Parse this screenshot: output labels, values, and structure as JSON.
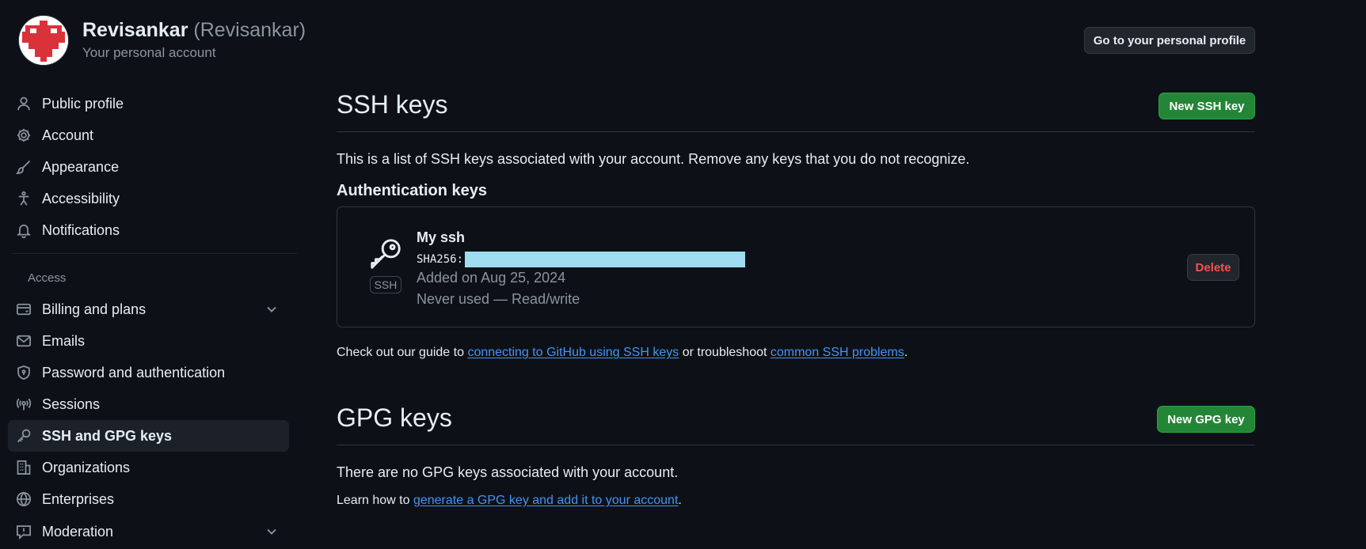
{
  "header": {
    "display_name": "Revisankar",
    "handle": "(Revisankar)",
    "subtitle": "Your personal account",
    "profile_button": "Go to your personal profile"
  },
  "sidebar": {
    "items": [
      {
        "label": "Public profile",
        "icon": "person-icon"
      },
      {
        "label": "Account",
        "icon": "gear-icon"
      },
      {
        "label": "Appearance",
        "icon": "paintbrush-icon"
      },
      {
        "label": "Accessibility",
        "icon": "accessibility-icon"
      },
      {
        "label": "Notifications",
        "icon": "bell-icon"
      }
    ],
    "access_heading": "Access",
    "access_items": [
      {
        "label": "Billing and plans",
        "icon": "credit-card-icon",
        "expandable": true
      },
      {
        "label": "Emails",
        "icon": "mail-icon"
      },
      {
        "label": "Password and authentication",
        "icon": "shield-lock-icon"
      },
      {
        "label": "Sessions",
        "icon": "broadcast-icon"
      },
      {
        "label": "SSH and GPG keys",
        "icon": "key-icon",
        "active": true
      },
      {
        "label": "Organizations",
        "icon": "organization-icon"
      },
      {
        "label": "Enterprises",
        "icon": "globe-icon"
      },
      {
        "label": "Moderation",
        "icon": "report-icon",
        "expandable": true
      }
    ]
  },
  "ssh": {
    "title": "SSH keys",
    "new_button": "New SSH key",
    "description": "This is a list of SSH keys associated with your account. Remove any keys that you do not recognize.",
    "auth_heading": "Authentication keys",
    "key": {
      "name": "My ssh",
      "badge": "SSH",
      "fingerprint_prefix": "SHA256:",
      "added": "Added on Aug 25, 2024",
      "usage": "Never used — Read/write",
      "delete_button": "Delete"
    },
    "guide": {
      "prefix": "Check out our guide to ",
      "link1": "connecting to GitHub using SSH keys",
      "middle": " or troubleshoot ",
      "link2": "common SSH problems",
      "suffix": "."
    }
  },
  "gpg": {
    "title": "GPG keys",
    "new_button": "New GPG key",
    "empty": "There are no GPG keys associated with your account.",
    "learn": {
      "prefix": "Learn how to ",
      "link": "generate a GPG key and add it to your account",
      "suffix": "."
    }
  },
  "colors": {
    "background": "#0d1117",
    "accent_blue": "#1f6feb",
    "link": "#4493f8",
    "green": "#238636",
    "danger": "#f85149"
  }
}
